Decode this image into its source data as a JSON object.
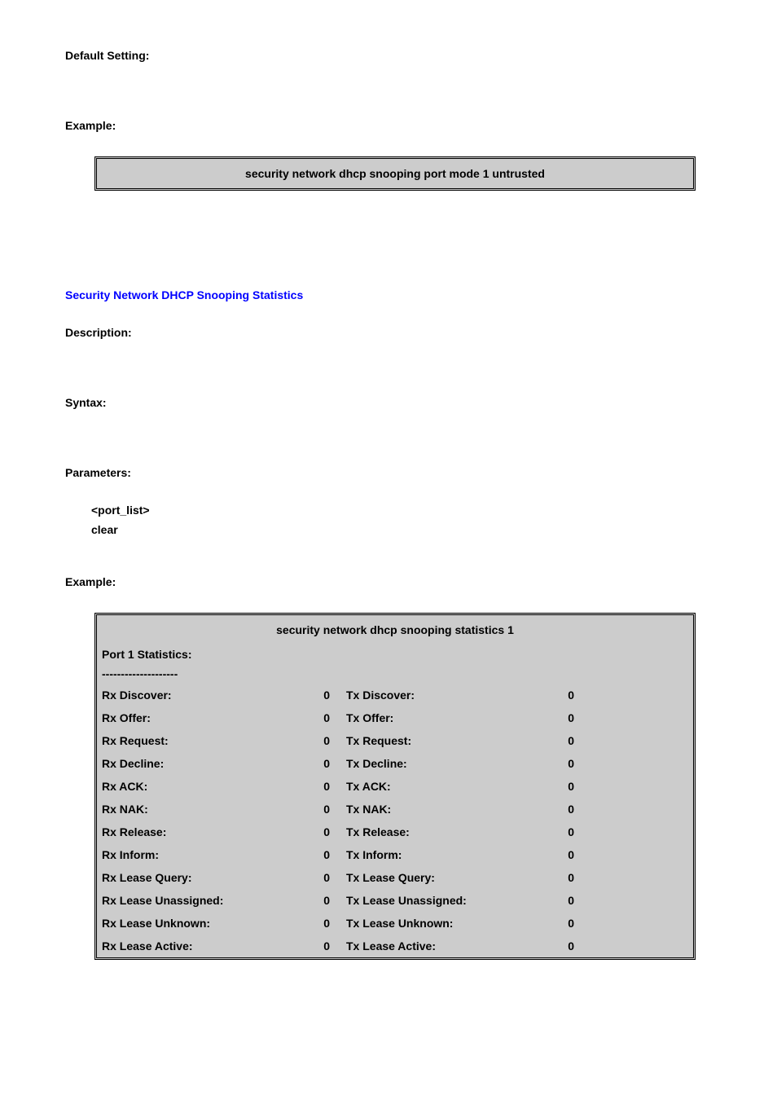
{
  "labels": {
    "default_setting": "Default Setting:",
    "example": "Example:",
    "description": "Description:",
    "syntax": "Syntax:",
    "parameters": "Parameters:"
  },
  "section_title": "Security Network DHCP Snooping Statistics",
  "command_box_1": "security network dhcp snooping port mode 1 untrusted",
  "params": {
    "port_list": "<port_list>",
    "clear": "clear"
  },
  "stats_command": "security network dhcp snooping statistics 1",
  "stats_subheader": "Port 1 Statistics:",
  "stats_dashes": "--------------------",
  "stats_rows": [
    {
      "rx_label": "Rx Discover:",
      "rx_value": "0",
      "tx_label": "Tx Discover:",
      "tx_value": "0"
    },
    {
      "rx_label": "Rx Offer:",
      "rx_value": "0",
      "tx_label": "Tx Offer:",
      "tx_value": "0"
    },
    {
      "rx_label": "Rx Request:",
      "rx_value": "0",
      "tx_label": "Tx Request:",
      "tx_value": "0"
    },
    {
      "rx_label": "Rx Decline:",
      "rx_value": "0",
      "tx_label": "Tx Decline:",
      "tx_value": "0"
    },
    {
      "rx_label": "Rx ACK:",
      "rx_value": "0",
      "tx_label": "Tx ACK:",
      "tx_value": "0"
    },
    {
      "rx_label": "Rx NAK:",
      "rx_value": "0",
      "tx_label": "Tx NAK:",
      "tx_value": "0"
    },
    {
      "rx_label": "Rx Release:",
      "rx_value": "0",
      "tx_label": "Tx Release:",
      "tx_value": "0"
    },
    {
      "rx_label": "Rx Inform:",
      "rx_value": "0",
      "tx_label": "Tx Inform:",
      "tx_value": "0"
    },
    {
      "rx_label": "Rx Lease Query:",
      "rx_value": "0",
      "tx_label": "Tx Lease Query:",
      "tx_value": "0"
    },
    {
      "rx_label": "Rx Lease Unassigned:",
      "rx_value": "0",
      "tx_label": "Tx Lease Unassigned:",
      "tx_value": "0"
    },
    {
      "rx_label": "Rx Lease Unknown:",
      "rx_value": "0",
      "tx_label": "Tx Lease Unknown:",
      "tx_value": "0"
    },
    {
      "rx_label": "Rx Lease Active:",
      "rx_value": "0",
      "tx_label": "Tx Lease Active:",
      "tx_value": "0"
    }
  ]
}
